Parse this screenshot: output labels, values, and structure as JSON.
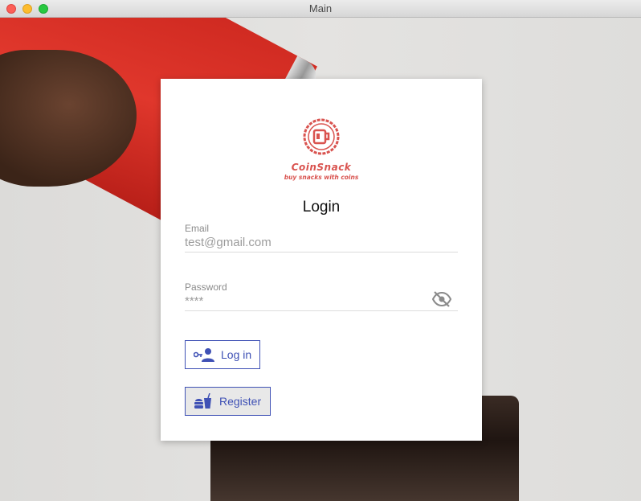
{
  "window": {
    "title": "Main"
  },
  "logo": {
    "brand": "CoinSnack",
    "tagline": "buy snacks with coins"
  },
  "form": {
    "heading": "Login",
    "email": {
      "label": "Email",
      "value": "test@gmail.com"
    },
    "password": {
      "label": "Password",
      "value": "****",
      "toggle_icon": "eye-off-icon"
    }
  },
  "buttons": {
    "login": {
      "label": "Log in",
      "icon": "key-person-icon"
    },
    "register": {
      "label": "Register",
      "icon": "fastfood-icon"
    }
  },
  "colors": {
    "accent": "#3f51b5",
    "brand": "#d9534f"
  }
}
